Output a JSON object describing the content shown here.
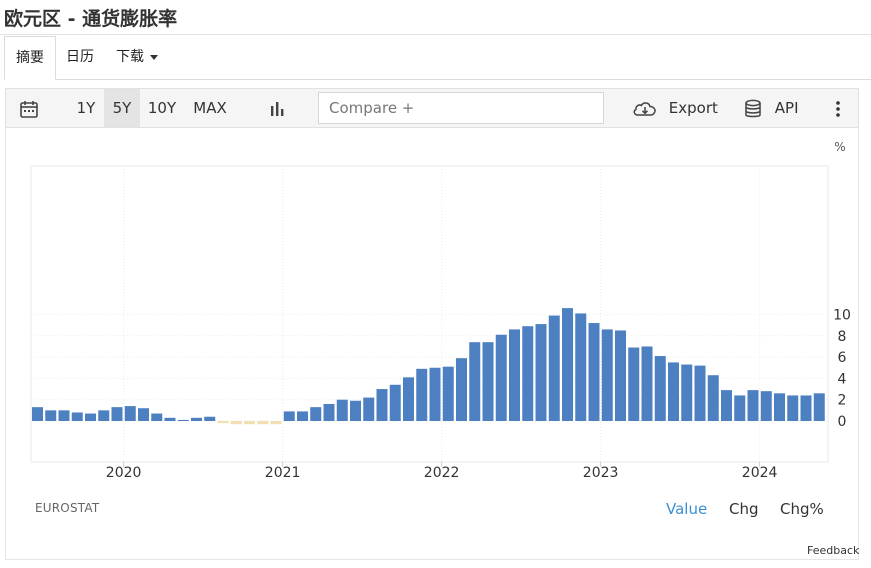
{
  "page": {
    "title": "欧元区 - 通货膨胀率"
  },
  "tabs": [
    {
      "label": "摘要",
      "active": true
    },
    {
      "label": "日历",
      "active": false
    },
    {
      "label": "下载",
      "active": false
    }
  ],
  "toolbar": {
    "calendar_icon": "calendar-icon",
    "ranges": [
      "1Y",
      "5Y",
      "10Y",
      "MAX"
    ],
    "selected_range": "5Y",
    "chart_type_icon": "bar-chart-icon",
    "compare_placeholder": "Compare +",
    "export_label": "Export",
    "export_icon": "cloud-download-icon",
    "api_label": "API",
    "api_icon": "database-icon",
    "more_icon": "more-vertical-icon"
  },
  "footer": {
    "source": "EUROSTAT",
    "modes": [
      "Value",
      "Chg",
      "Chg%"
    ],
    "active_mode": "Value",
    "feedback": "Feedback"
  },
  "chart_data": {
    "type": "bar",
    "unit_label": "%",
    "ylim": [
      -2,
      12
    ],
    "y_ticks": [
      0,
      2,
      4,
      6,
      8,
      10
    ],
    "x_tick_labels": [
      "2020",
      "2021",
      "2022",
      "2023",
      "2024"
    ],
    "start": "2019-06",
    "months": [
      "2019-06",
      "2019-07",
      "2019-08",
      "2019-09",
      "2019-10",
      "2019-11",
      "2019-12",
      "2020-01",
      "2020-02",
      "2020-03",
      "2020-04",
      "2020-05",
      "2020-06",
      "2020-07",
      "2020-08",
      "2020-09",
      "2020-10",
      "2020-11",
      "2020-12",
      "2021-01",
      "2021-02",
      "2021-03",
      "2021-04",
      "2021-05",
      "2021-06",
      "2021-07",
      "2021-08",
      "2021-09",
      "2021-10",
      "2021-11",
      "2021-12",
      "2022-01",
      "2022-02",
      "2022-03",
      "2022-04",
      "2022-05",
      "2022-06",
      "2022-07",
      "2022-08",
      "2022-09",
      "2022-10",
      "2022-11",
      "2022-12",
      "2023-01",
      "2023-02",
      "2023-03",
      "2023-04",
      "2023-05",
      "2023-06",
      "2023-07",
      "2023-08",
      "2023-09",
      "2023-10",
      "2023-11",
      "2023-12",
      "2024-01",
      "2024-02",
      "2024-03",
      "2024-04",
      "2024-05"
    ],
    "values": [
      1.3,
      1.0,
      1.0,
      0.8,
      0.7,
      1.0,
      1.3,
      1.4,
      1.2,
      0.7,
      0.3,
      0.1,
      0.3,
      0.4,
      -0.2,
      -0.3,
      -0.3,
      -0.3,
      -0.3,
      0.9,
      0.9,
      1.3,
      1.6,
      2.0,
      1.9,
      2.2,
      3.0,
      3.4,
      4.1,
      4.9,
      5.0,
      5.1,
      5.9,
      7.4,
      7.4,
      8.1,
      8.6,
      8.9,
      9.1,
      9.9,
      10.6,
      10.1,
      9.2,
      8.6,
      8.5,
      6.9,
      7.0,
      6.1,
      5.5,
      5.3,
      5.2,
      4.3,
      2.9,
      2.4,
      2.9,
      2.8,
      2.6,
      2.4,
      2.4,
      2.6
    ],
    "colors": {
      "positive": "#4d80c0",
      "negative": "#f1dfb2"
    },
    "grid": true
  }
}
